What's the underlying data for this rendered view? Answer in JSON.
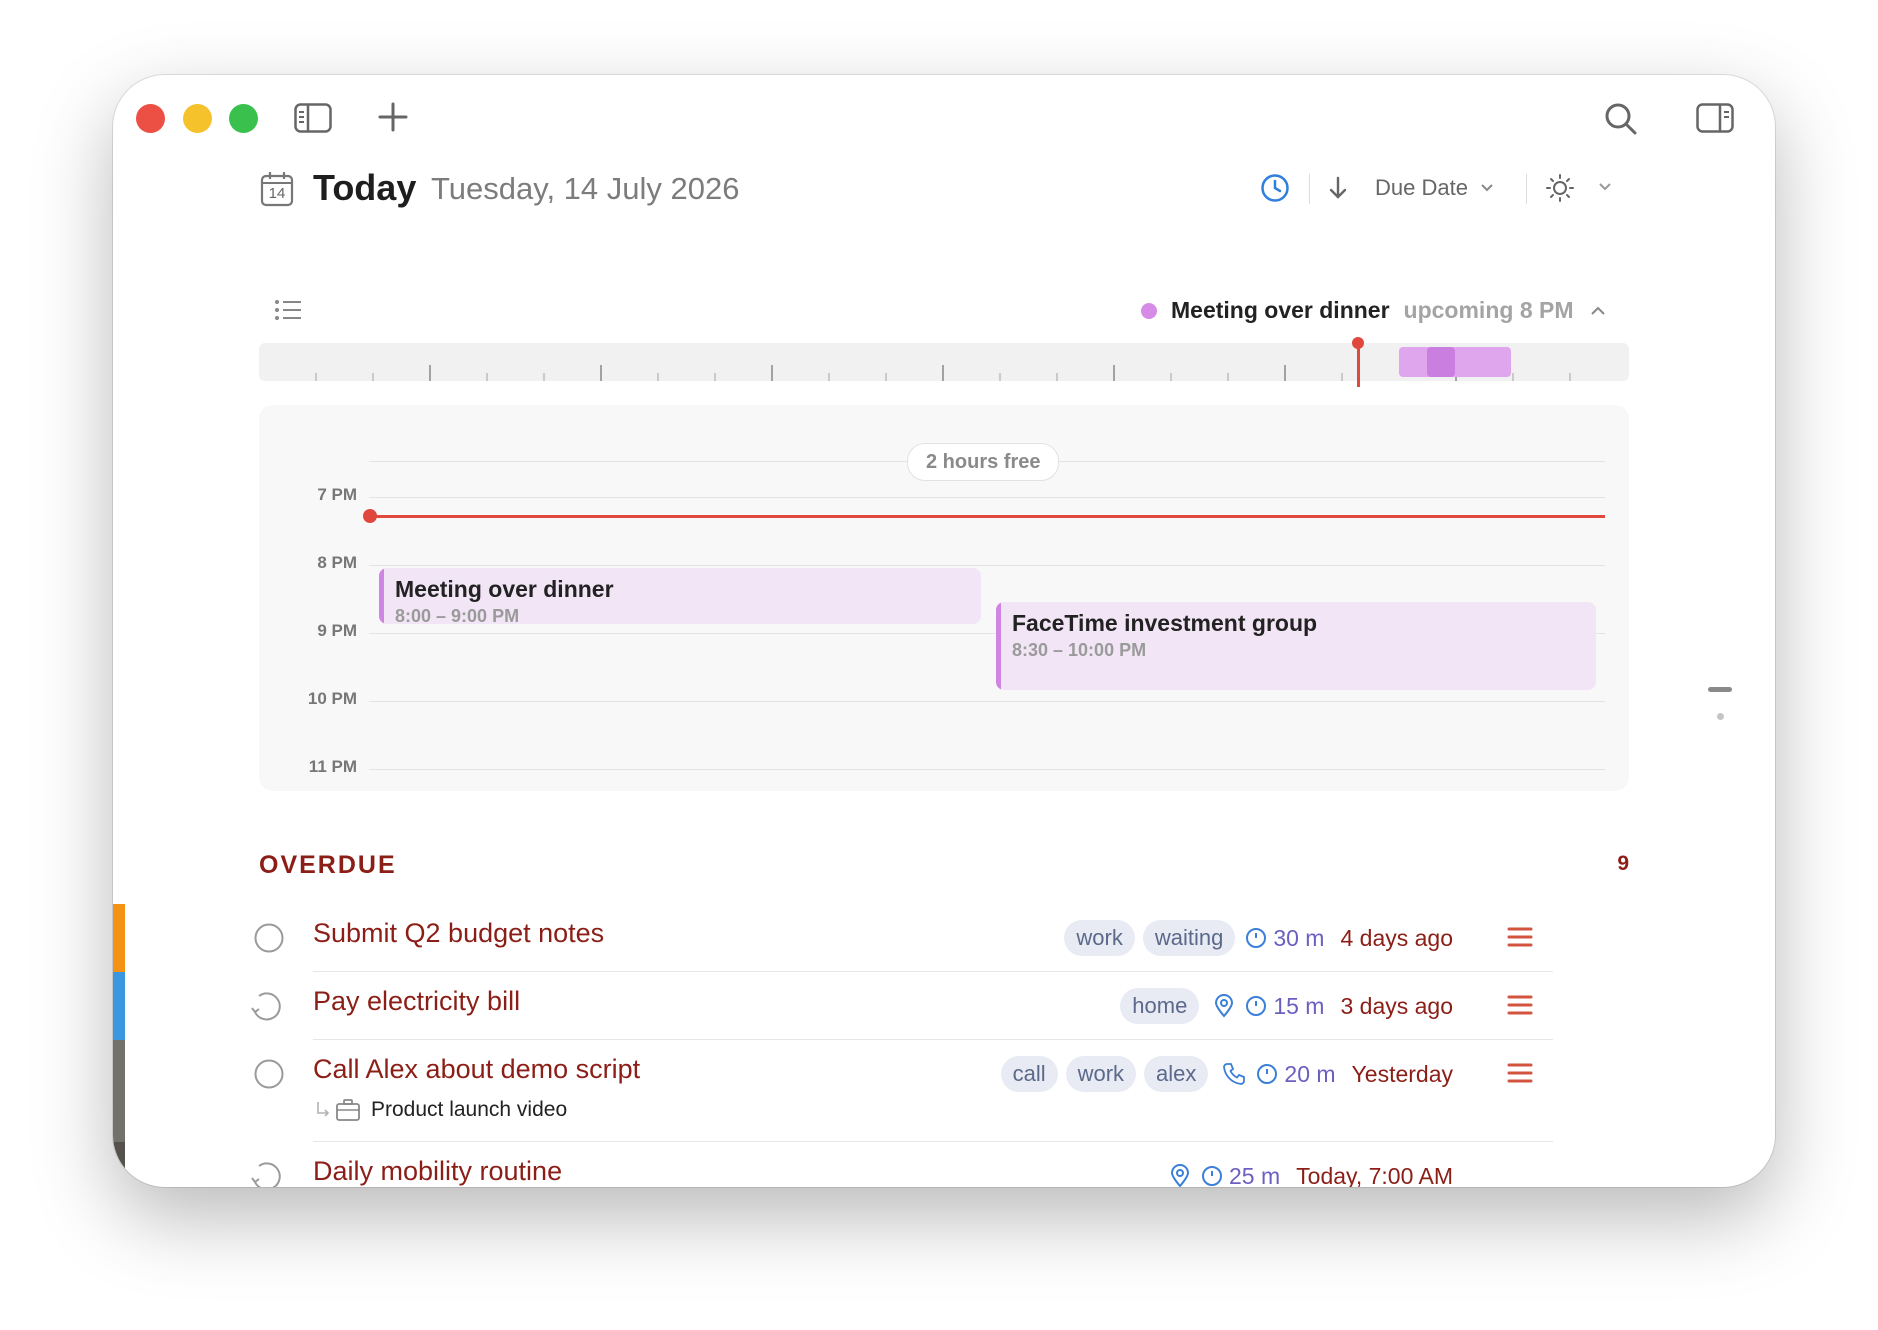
{
  "window": {
    "title": "Today",
    "date": "Tuesday, 14 July 2026",
    "calendar_day": "14"
  },
  "toolbar": {
    "sort_label": "Due Date"
  },
  "timeline": {
    "next_event_title": "Meeting over dinner",
    "next_event_status": "upcoming 8 PM",
    "free_label": "2 hours free",
    "hours": [
      "7 PM",
      "8 PM",
      "9 PM",
      "10 PM",
      "11 PM"
    ],
    "events": [
      {
        "title": "Meeting over dinner",
        "time": "8:00 – 9:00 PM"
      },
      {
        "title": "FaceTime investment group",
        "time": "8:30 – 10:00 PM"
      }
    ]
  },
  "overdue": {
    "heading": "OVERDUE",
    "count": "9",
    "tasks": [
      {
        "title": "Submit Q2 budget notes",
        "tags": [
          "work",
          "waiting"
        ],
        "duration": "30 m",
        "when": "4 days ago",
        "color": "#f39214"
      },
      {
        "title": "Pay electricity bill",
        "tags": [
          "home"
        ],
        "duration": "15 m",
        "when": "3 days ago",
        "color": "#3a97e0"
      },
      {
        "title": "Call Alex about demo script",
        "tags": [
          "call",
          "work",
          "alex"
        ],
        "duration": "20 m",
        "when": "Yesterday",
        "subtask": "Product launch video",
        "color": "#73716c"
      },
      {
        "title": "Daily mobility routine",
        "tags": [],
        "duration": "25 m",
        "when": "Today, 7:00 AM",
        "color": "#55524e"
      }
    ]
  },
  "colors": {
    "accent_red": "#8b1e16",
    "event_purple": "#d68be6",
    "now_line": "#e0483e",
    "tag_bg": "#e8eaf4"
  }
}
